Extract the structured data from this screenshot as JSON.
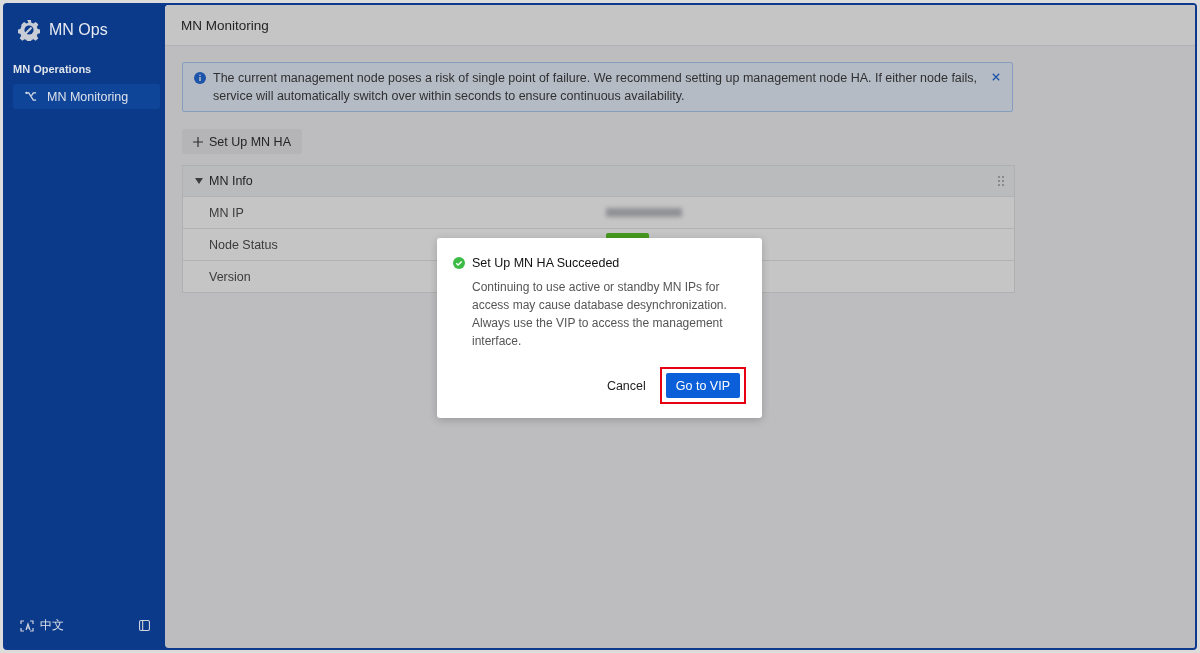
{
  "sidebar": {
    "title": "MN Ops",
    "section": "MN Operations",
    "items": [
      {
        "label": "MN Monitoring",
        "selected": true
      }
    ],
    "language": "中文"
  },
  "header": {
    "title": "MN Monitoring"
  },
  "alert": {
    "text": "The current management node poses a risk of single point of failure. We recommend setting up management node HA. If either node fails, service will automatically switch over within seconds to ensure continuous availability."
  },
  "action_button": {
    "label": "Set Up MN HA"
  },
  "panel": {
    "title": "MN Info",
    "expanded": true,
    "rows": [
      {
        "label": "MN IP",
        "kind": "redacted"
      },
      {
        "label": "Node Status",
        "kind": "badge"
      },
      {
        "label": "Version",
        "kind": "hidden"
      }
    ]
  },
  "dialog": {
    "title": "Set Up MN HA Succeeded",
    "message": "Continuing to use active or standby MN IPs for access may cause database desynchronization. Always use the VIP to access the management interface.",
    "buttons": [
      {
        "label": "Cancel",
        "kind": "text",
        "highlighted": false
      },
      {
        "label": "Go to VIP",
        "kind": "primary",
        "highlighted": true
      }
    ]
  }
}
